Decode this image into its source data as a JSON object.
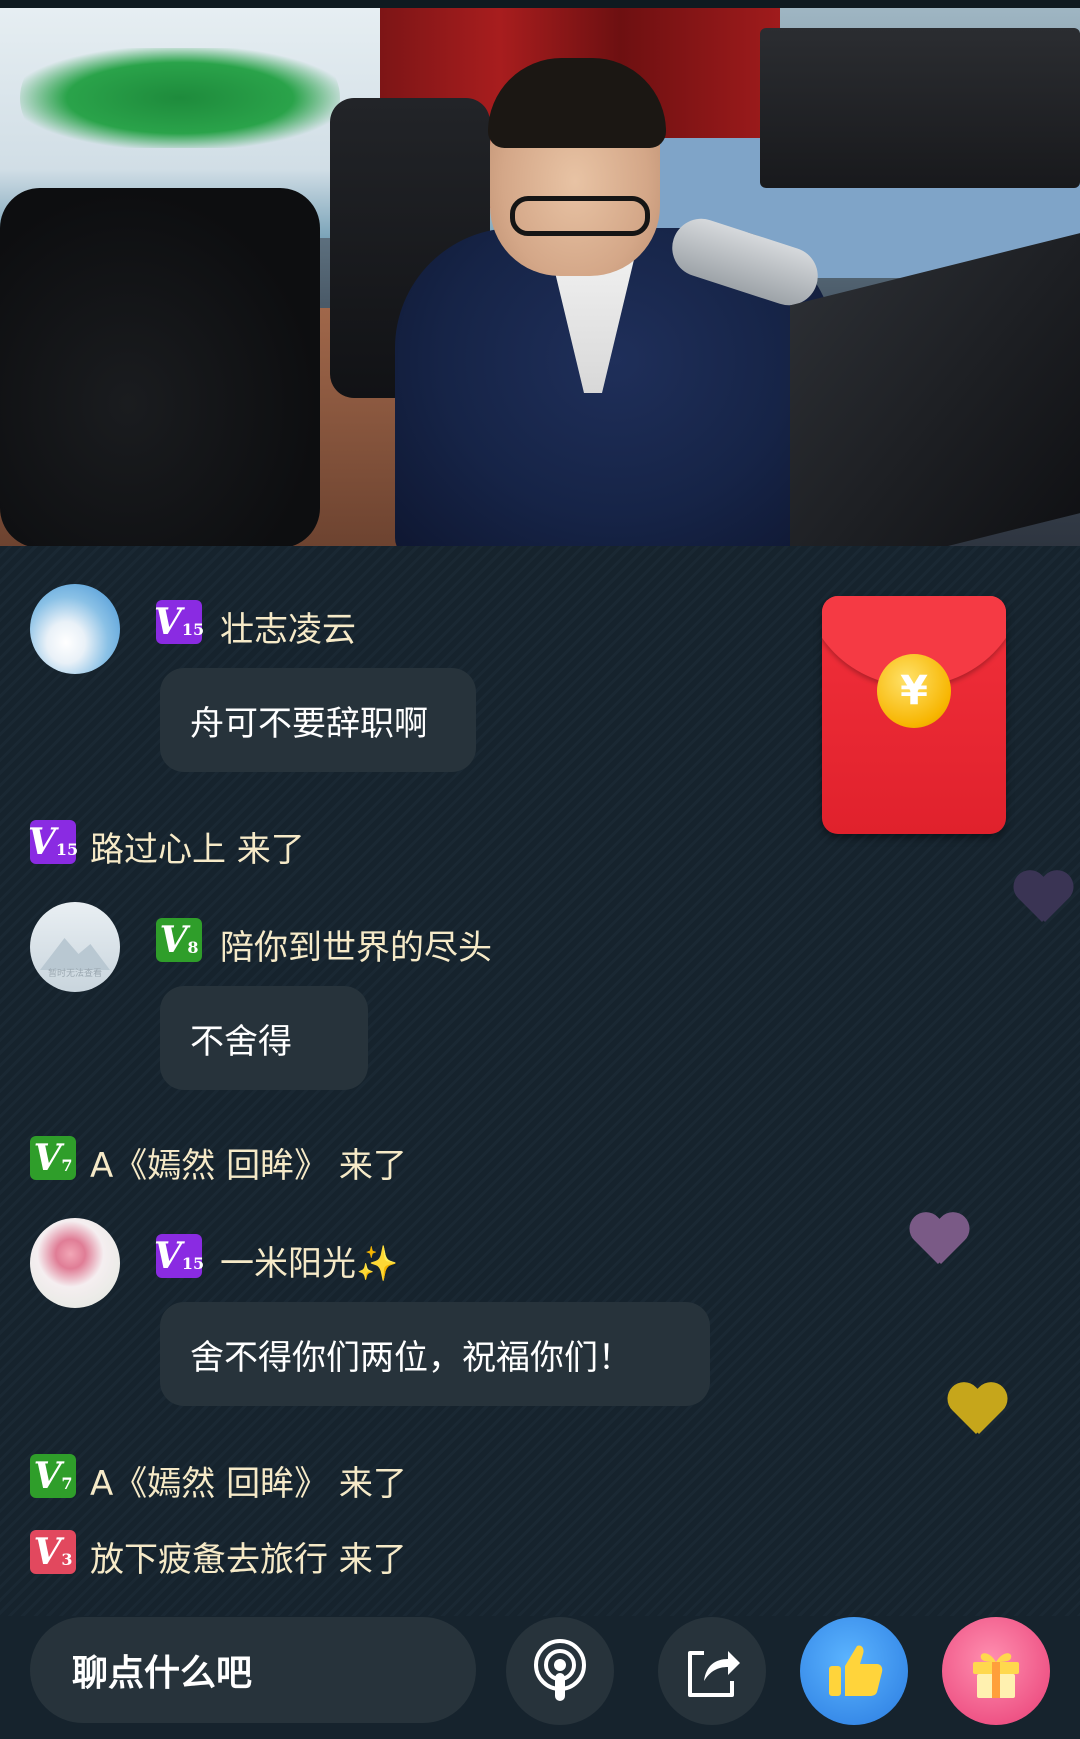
{
  "comments": [
    {
      "level": "15",
      "level_color": "purple",
      "username": "壮志凌云",
      "message": "舟可不要辞职啊"
    },
    {
      "level": "8",
      "level_color": "green",
      "username": "陪你到世界的尽头",
      "message": "不舍得"
    },
    {
      "level": "15",
      "level_color": "purple",
      "username": "一米阳光✨",
      "message": "舍不得你们两位，祝福你们！"
    }
  ],
  "entries": [
    {
      "level": "15",
      "text": "路过心上 来了"
    },
    {
      "level": "7",
      "text": "A《嫣然 回眸》 来了"
    },
    {
      "level": "7",
      "text": "A《嫣然 回眸》 来了"
    },
    {
      "level": "3",
      "text": "放下疲惫去旅行 来了"
    }
  ],
  "avatar_placeholder_text": "暂时无法查看",
  "level_prefix": "V",
  "red_packet": {
    "symbol": "¥"
  },
  "composer": {
    "placeholder": "聊点什么吧"
  },
  "actions": [
    {
      "icon": "podcast-icon"
    },
    {
      "icon": "share-icon"
    },
    {
      "icon": "thumbs-up-icon"
    },
    {
      "icon": "gift-icon"
    }
  ],
  "colors": {
    "background": "#16232d",
    "bubble": "#27333b",
    "username": "#f6eac8",
    "level_purple": "#8a2be2",
    "level_green": "#2f9e2a",
    "level_pink": "#e2485e",
    "red_packet": "#f2303b"
  }
}
